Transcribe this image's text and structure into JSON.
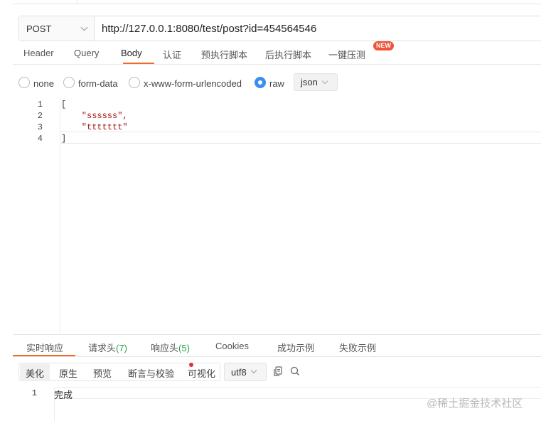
{
  "request": {
    "method": "POST",
    "url": "http://127.0.0.1:8080/test/post?id=454564546"
  },
  "request_tabs": [
    {
      "label": "Header"
    },
    {
      "label": "Query"
    },
    {
      "label": "Body",
      "active": true
    },
    {
      "label": "认证"
    },
    {
      "label": "预执行脚本"
    },
    {
      "label": "后执行脚本"
    },
    {
      "label": "一键压测",
      "badge": "NEW"
    }
  ],
  "body_types": {
    "options": [
      "none",
      "form-data",
      "x-www-form-urlencoded",
      "raw"
    ],
    "selected": "raw",
    "format": "json"
  },
  "editor": {
    "lines": [
      {
        "num": "1",
        "text": "["
      },
      {
        "num": "2",
        "text": "    \"ssssss\","
      },
      {
        "num": "3",
        "text": "    \"ttttttt\""
      },
      {
        "num": "4",
        "text": "]"
      }
    ]
  },
  "response_tabs": {
    "realtime": "实时响应",
    "req_headers": "请求头",
    "req_headers_count": "(7)",
    "resp_headers": "响应头",
    "resp_headers_count": "(5)",
    "cookies": "Cookies",
    "success_example": "成功示例",
    "fail_example": "失败示例"
  },
  "response_toolbar": {
    "beautify": "美化",
    "raw": "原生",
    "preview": "预览",
    "assert": "断言与校验",
    "visualize": "可视化",
    "encoding": "utf8",
    "icons": [
      "copy-icon",
      "search-icon"
    ]
  },
  "response_body": {
    "line_num": "1",
    "text": "完成"
  },
  "watermark": "@稀土掘金技术社区",
  "colors": {
    "accent": "#f06a2f",
    "radio_checked": "#3b8ef0",
    "count_green": "#2aa04a",
    "badge_red": "#f0553a"
  }
}
